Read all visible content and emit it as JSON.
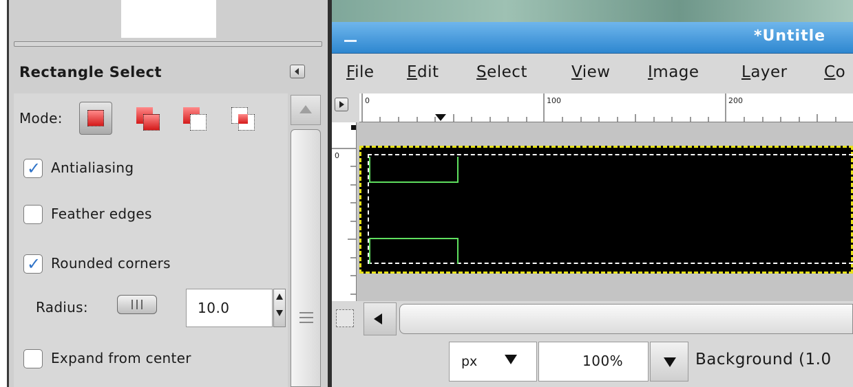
{
  "tool_options": {
    "title": "Rectangle Select",
    "mode_label": "Mode:",
    "modes": [
      {
        "name": "replace",
        "active": true
      },
      {
        "name": "add"
      },
      {
        "name": "subtract"
      },
      {
        "name": "intersect"
      }
    ],
    "antialiasing": {
      "label": "Antialiasing",
      "checked": true
    },
    "feather_edges": {
      "label": "Feather edges",
      "checked": false
    },
    "rounded_corners": {
      "label": "Rounded corners",
      "checked": true
    },
    "radius": {
      "label": "Radius:",
      "value": "10.0"
    },
    "expand_from_center": {
      "label": "Expand from center",
      "checked": false
    }
  },
  "image_window": {
    "title": "*Untitle",
    "menu": [
      "File",
      "Edit",
      "Select",
      "View",
      "Image",
      "Layer",
      "Co"
    ],
    "ruler_h_labels": [
      "0",
      "100",
      "200"
    ],
    "ruler_v_labels": [
      "0"
    ],
    "status": {
      "unit": "px",
      "zoom": "100%",
      "layer": "Background (1.0"
    }
  },
  "colors": {
    "titlebar": "#2e87d0",
    "selection_border": "#e7e21a",
    "rounded_guide": "#5fe05f",
    "check": "#2f73c8"
  }
}
